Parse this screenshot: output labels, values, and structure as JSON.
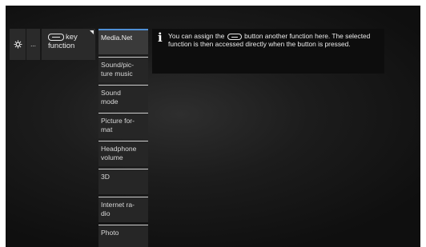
{
  "breadcrumb": {
    "gear_icon": "gear-icon",
    "more_label": "...",
    "key_function_label_line1": "key",
    "key_function_label_line2": "function"
  },
  "menu": {
    "items": [
      {
        "label_lines": [
          "Media.Net"
        ],
        "selected": true
      },
      {
        "label_lines": [
          "Sound/pic-",
          "ture music"
        ],
        "selected": false
      },
      {
        "label_lines": [
          "Sound",
          "mode"
        ],
        "selected": false
      },
      {
        "label_lines": [
          "Picture for-",
          "mat"
        ],
        "selected": false
      },
      {
        "label_lines": [
          "Headphone",
          "volume"
        ],
        "selected": false
      },
      {
        "label_lines": [
          "3D"
        ],
        "selected": false
      },
      {
        "label_lines": [
          "Internet ra-",
          "dio"
        ],
        "selected": false
      },
      {
        "label_lines": [
          "Photo"
        ],
        "selected": false
      }
    ]
  },
  "info": {
    "icon": "i",
    "text_before_button": "You can assign the",
    "text_after_button": "button another function here. The selected function is then accessed directly when the button is pressed."
  },
  "colors": {
    "selected_accent": "#4f8fd6"
  }
}
